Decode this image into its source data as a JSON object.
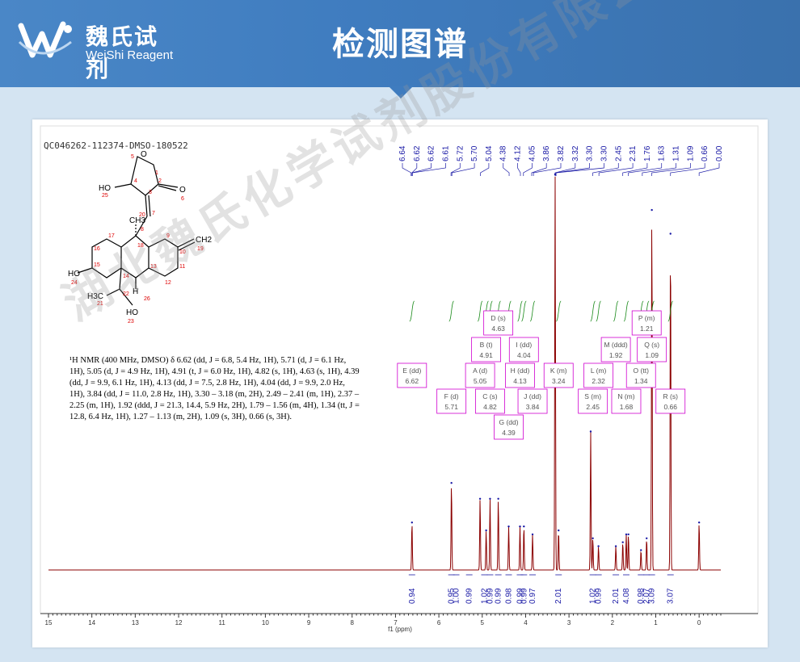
{
  "brand": {
    "name_cn": "魏氏试剂",
    "name_en": "WeiShi Reagent",
    "color": "#ffffff"
  },
  "page_title": "检测图谱",
  "sample_id": "QC046262-112374-DMSO-180522",
  "watermark": "湖北魏氏化学试剂股份有限公司",
  "nmr_description": "¹H NMR (400 MHz, DMSO) δ 6.62 (dd, J = 6.8, 5.4 Hz, 1H), 5.71 (d, J = 6.1 Hz, 1H), 5.05 (d, J = 4.9 Hz, 1H), 4.91 (t, J = 6.0 Hz, 1H), 4.82 (s, 1H), 4.63 (s, 1H), 4.39 (dd, J = 9.9, 6.1 Hz, 1H), 4.13 (dd, J = 7.5, 2.8 Hz, 1H), 4.04 (dd, J = 9.9, 2.0 Hz, 1H), 3.84 (dd, J = 11.0, 2.8 Hz, 1H), 3.30 – 3.18 (m, 2H), 2.49 – 2.41 (m, 1H), 2.37 – 2.25 (m, 1H), 1.92 (ddd, J = 21.3, 14.4, 5.9 Hz, 2H), 1.79 – 1.56 (m, 4H), 1.34 (tt, J = 12.8, 6.4 Hz, 1H), 1.27 – 1.13 (m, 2H), 1.09 (s, 3H), 0.66 (s, 3H).",
  "molecule": {
    "atom_labels": [
      "O",
      "O",
      "HO",
      "CH3",
      "CH2",
      "HO",
      "H3C",
      "H",
      "HO"
    ],
    "numbers": [
      "1",
      "2",
      "3",
      "4",
      "5",
      "6",
      "7",
      "8",
      "9",
      "10",
      "11",
      "12",
      "13",
      "14",
      "15",
      "16",
      "17",
      "18",
      "19",
      "20",
      "21",
      "22",
      "23",
      "24",
      "25",
      "26"
    ]
  },
  "chart_data": {
    "type": "line",
    "title": "",
    "xlabel": "f1 (ppm)",
    "xlim": [
      15,
      -0.5
    ],
    "xticks": [
      15,
      14,
      13,
      12,
      11,
      10,
      9,
      8,
      7,
      6,
      5,
      4,
      3,
      2,
      1,
      0
    ],
    "peak_labels_top": [
      "6.64",
      "6.62",
      "6.62",
      "6.61",
      "5.72",
      "5.70",
      "5.04",
      "4.38",
      "4.12",
      "4.05",
      "3.86",
      "3.82",
      "3.32",
      "3.30",
      "3.30",
      "2.45",
      "2.31",
      "1.76",
      "1.63",
      "1.31",
      "1.09",
      "0.66",
      "0.00"
    ],
    "peaks": [
      {
        "ppm": 6.62,
        "height": 0.12
      },
      {
        "ppm": 5.71,
        "height": 0.22
      },
      {
        "ppm": 5.05,
        "height": 0.18
      },
      {
        "ppm": 4.91,
        "height": 0.1
      },
      {
        "ppm": 4.82,
        "height": 0.18
      },
      {
        "ppm": 4.63,
        "height": 0.18
      },
      {
        "ppm": 4.39,
        "height": 0.11
      },
      {
        "ppm": 4.13,
        "height": 0.11
      },
      {
        "ppm": 4.04,
        "height": 0.11
      },
      {
        "ppm": 3.84,
        "height": 0.09
      },
      {
        "ppm": 3.32,
        "height": 1.0
      },
      {
        "ppm": 3.24,
        "height": 0.1
      },
      {
        "ppm": 2.5,
        "height": 0.35
      },
      {
        "ppm": 2.45,
        "height": 0.08
      },
      {
        "ppm": 2.32,
        "height": 0.06
      },
      {
        "ppm": 1.92,
        "height": 0.06
      },
      {
        "ppm": 1.76,
        "height": 0.07
      },
      {
        "ppm": 1.68,
        "height": 0.09
      },
      {
        "ppm": 1.63,
        "height": 0.09
      },
      {
        "ppm": 1.34,
        "height": 0.05
      },
      {
        "ppm": 1.21,
        "height": 0.08
      },
      {
        "ppm": 1.09,
        "height": 0.91
      },
      {
        "ppm": 0.66,
        "height": 0.85
      },
      {
        "ppm": 0.0,
        "height": 0.12
      }
    ],
    "multiplets": [
      {
        "letter": "A",
        "mult": "d",
        "ppm": "5.05"
      },
      {
        "letter": "B",
        "mult": "t",
        "ppm": "4.91"
      },
      {
        "letter": "C",
        "mult": "s",
        "ppm": "4.82"
      },
      {
        "letter": "D",
        "mult": "s",
        "ppm": "4.63"
      },
      {
        "letter": "E",
        "mult": "dd",
        "ppm": "6.62"
      },
      {
        "letter": "F",
        "mult": "d",
        "ppm": "5.71"
      },
      {
        "letter": "G",
        "mult": "dd",
        "ppm": "4.39"
      },
      {
        "letter": "H",
        "mult": "dd",
        "ppm": "4.13"
      },
      {
        "letter": "I",
        "mult": "dd",
        "ppm": "4.04"
      },
      {
        "letter": "J",
        "mult": "dd",
        "ppm": "3.84"
      },
      {
        "letter": "K",
        "mult": "m",
        "ppm": "3.24"
      },
      {
        "letter": "L",
        "mult": "m",
        "ppm": "2.32"
      },
      {
        "letter": "M",
        "mult": "ddd",
        "ppm": "1.92"
      },
      {
        "letter": "N",
        "mult": "m",
        "ppm": "1.68"
      },
      {
        "letter": "O",
        "mult": "tt",
        "ppm": "1.34"
      },
      {
        "letter": "P",
        "mult": "m",
        "ppm": "1.21"
      },
      {
        "letter": "Q",
        "mult": "s",
        "ppm": "1.09"
      },
      {
        "letter": "R",
        "mult": "s",
        "ppm": "0.66"
      },
      {
        "letter": "S",
        "mult": "m",
        "ppm": "2.45"
      }
    ],
    "integrals": [
      {
        "ppm": 6.62,
        "value": "0.94"
      },
      {
        "ppm": 5.71,
        "value": "0.95"
      },
      {
        "ppm": 5.6,
        "value": "1.00"
      },
      {
        "ppm": 5.3,
        "value": "0.99"
      },
      {
        "ppm": 4.95,
        "value": "1.02"
      },
      {
        "ppm": 4.82,
        "value": "0.99"
      },
      {
        "ppm": 4.63,
        "value": "0.99"
      },
      {
        "ppm": 4.39,
        "value": "0.98"
      },
      {
        "ppm": 4.13,
        "value": "0.99"
      },
      {
        "ppm": 4.04,
        "value": "0.99"
      },
      {
        "ppm": 3.84,
        "value": "0.97"
      },
      {
        "ppm": 3.24,
        "value": "2.01"
      },
      {
        "ppm": 2.45,
        "value": "1.02"
      },
      {
        "ppm": 2.32,
        "value": "0.99"
      },
      {
        "ppm": 1.92,
        "value": "2.01"
      },
      {
        "ppm": 1.68,
        "value": "4.08"
      },
      {
        "ppm": 1.34,
        "value": "0.98"
      },
      {
        "ppm": 1.21,
        "value": "2.07"
      },
      {
        "ppm": 1.09,
        "value": "3.09"
      },
      {
        "ppm": 0.66,
        "value": "3.07"
      }
    ],
    "colors": {
      "spectrum": "#8b0000",
      "labels": "#1a1aa6",
      "multiplet_box": "#d000d0",
      "integral": "#1a8a1a",
      "axis": "#333333"
    }
  }
}
